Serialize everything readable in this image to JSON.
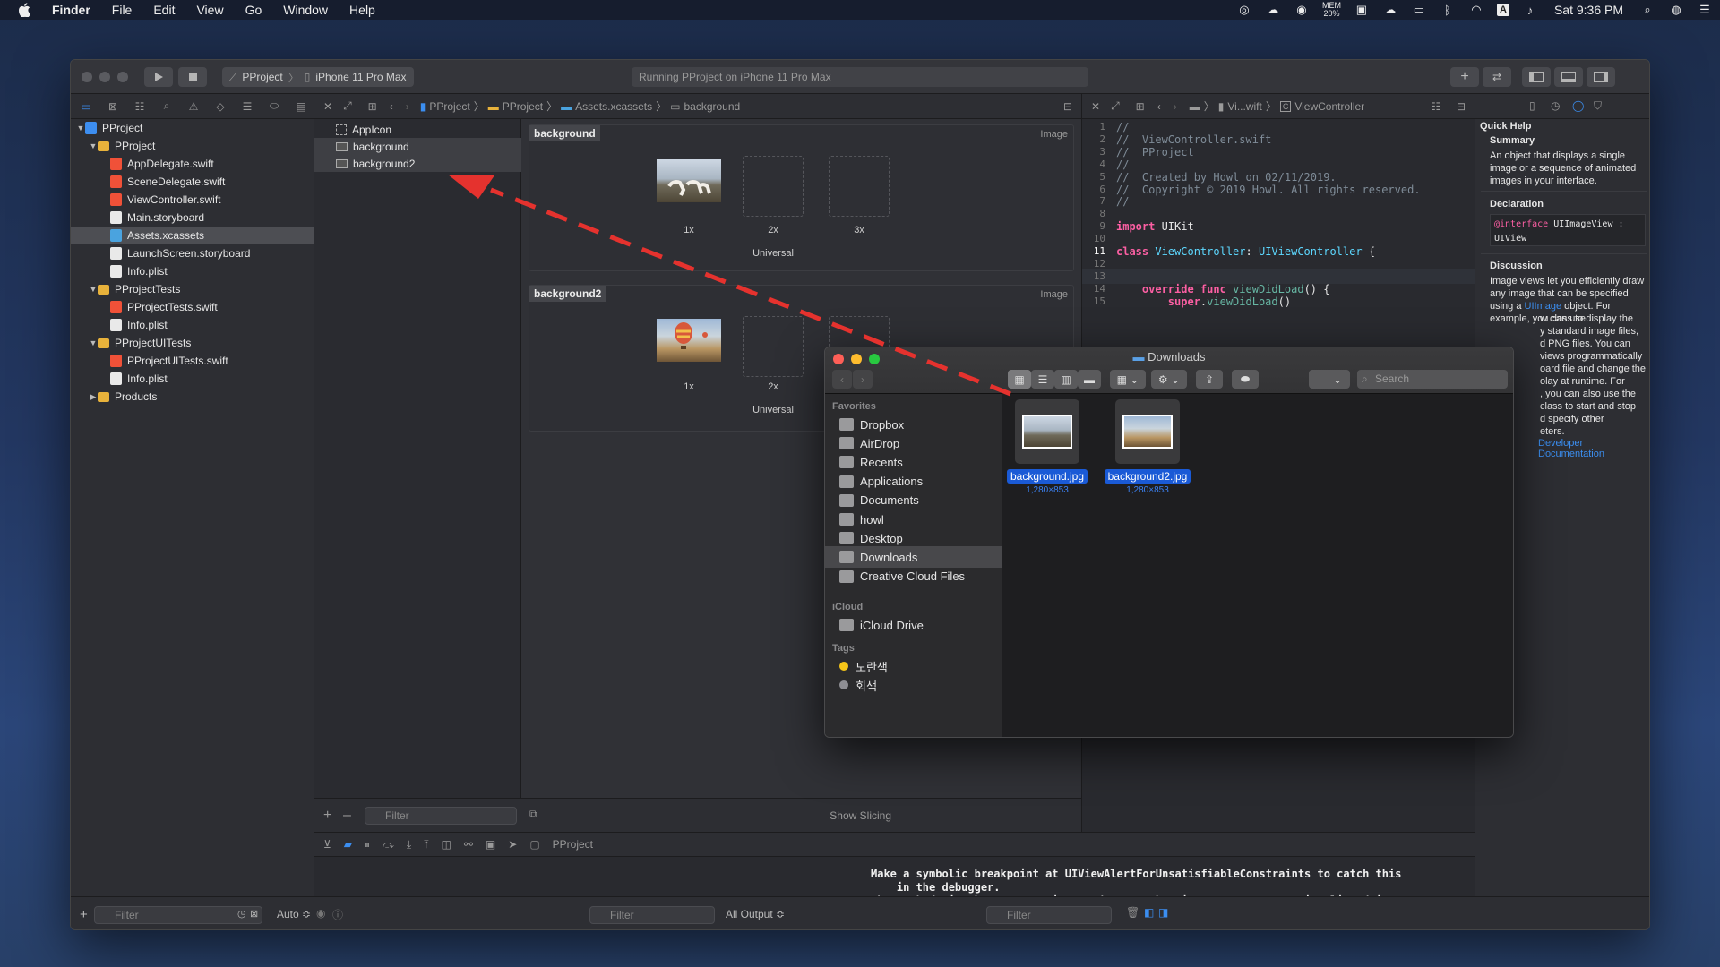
{
  "menubar": {
    "app": "Finder",
    "items": [
      "File",
      "Edit",
      "View",
      "Go",
      "Window",
      "Help"
    ],
    "mem": "MEM",
    "mem_pct": "20%",
    "clock": "Sat 9:36 PM"
  },
  "toolbar": {
    "scheme_project": "PProject",
    "scheme_device": "iPhone 11 Pro Max",
    "activity": "Running PProject on iPhone 11 Pro Max"
  },
  "navigator": {
    "tree": [
      {
        "label": "PProject",
        "kind": "proj",
        "level": 0,
        "disc": "▼"
      },
      {
        "label": "PProject",
        "kind": "folder",
        "level": 1,
        "disc": "▼"
      },
      {
        "label": "AppDelegate.swift",
        "kind": "swift",
        "level": 2
      },
      {
        "label": "SceneDelegate.swift",
        "kind": "swift",
        "level": 2
      },
      {
        "label": "ViewController.swift",
        "kind": "swift",
        "level": 2
      },
      {
        "label": "Main.storyboard",
        "kind": "doc",
        "level": 2
      },
      {
        "label": "Assets.xcassets",
        "kind": "xcas",
        "level": 2,
        "selected": true
      },
      {
        "label": "LaunchScreen.storyboard",
        "kind": "doc",
        "level": 2
      },
      {
        "label": "Info.plist",
        "kind": "doc",
        "level": 2
      },
      {
        "label": "PProjectTests",
        "kind": "folder",
        "level": 1,
        "disc": "▼"
      },
      {
        "label": "PProjectTests.swift",
        "kind": "swift",
        "level": 2
      },
      {
        "label": "Info.plist",
        "kind": "doc",
        "level": 2
      },
      {
        "label": "PProjectUITests",
        "kind": "folder",
        "level": 1,
        "disc": "▼"
      },
      {
        "label": "PProjectUITests.swift",
        "kind": "swift",
        "level": 2
      },
      {
        "label": "Info.plist",
        "kind": "doc",
        "level": 2
      },
      {
        "label": "Products",
        "kind": "folder",
        "level": 1,
        "disc": "▶"
      }
    ],
    "filter_placeholder": "Filter"
  },
  "assets": {
    "breadcrumb": [
      "PProject",
      "PProject",
      "Assets.xcassets",
      "background"
    ],
    "list": [
      {
        "label": "AppIcon"
      },
      {
        "label": "background",
        "selected": true
      },
      {
        "label": "background2",
        "selected": true
      }
    ],
    "sets": [
      {
        "name": "background",
        "type": "Image",
        "scales": [
          "1x",
          "2x",
          "3x"
        ],
        "group": "Universal"
      },
      {
        "name": "background2",
        "type": "Image",
        "scales": [
          "1x",
          "2x"
        ],
        "group": "Universal"
      }
    ],
    "filter_placeholder": "Filter",
    "show_slicing": "Show Slicing"
  },
  "editor": {
    "breadcrumb_file": "Vi...wift",
    "breadcrumb_symbol": "ViewController",
    "lines": [
      {
        "n": "1",
        "segs": [
          {
            "t": "//",
            "c": "cmt"
          }
        ]
      },
      {
        "n": "2",
        "segs": [
          {
            "t": "//  ViewController.swift",
            "c": "cmt"
          }
        ]
      },
      {
        "n": "3",
        "segs": [
          {
            "t": "//  PProject",
            "c": "cmt"
          }
        ]
      },
      {
        "n": "4",
        "segs": [
          {
            "t": "//",
            "c": "cmt"
          }
        ]
      },
      {
        "n": "5",
        "segs": [
          {
            "t": "//  Created by Howl on 02/11/2019.",
            "c": "cmt"
          }
        ]
      },
      {
        "n": "6",
        "segs": [
          {
            "t": "//  Copyright © 2019 Howl. All rights reserved.",
            "c": "cmt"
          }
        ]
      },
      {
        "n": "7",
        "segs": [
          {
            "t": "//",
            "c": "cmt"
          }
        ]
      },
      {
        "n": "8",
        "segs": []
      },
      {
        "n": "9",
        "segs": [
          {
            "t": "import",
            "c": "kw"
          },
          {
            "t": " UIKit",
            "c": ""
          }
        ]
      },
      {
        "n": "10",
        "segs": []
      },
      {
        "n": "11",
        "segs": [
          {
            "t": "class",
            "c": "kw"
          },
          {
            "t": " ",
            "c": ""
          },
          {
            "t": "ViewController",
            "c": "ty"
          },
          {
            "t": ": ",
            "c": ""
          },
          {
            "t": "UIViewController",
            "c": "ty"
          },
          {
            "t": " {",
            "c": ""
          }
        ]
      },
      {
        "n": "12",
        "segs": []
      },
      {
        "n": "13",
        "segs": []
      },
      {
        "n": "14",
        "segs": [
          {
            "t": "    ",
            "c": ""
          },
          {
            "t": "override",
            "c": "kw"
          },
          {
            "t": " ",
            "c": ""
          },
          {
            "t": "func",
            "c": "kw"
          },
          {
            "t": " ",
            "c": ""
          },
          {
            "t": "viewDidLoad",
            "c": "fn"
          },
          {
            "t": "() {",
            "c": ""
          }
        ]
      },
      {
        "n": "15",
        "segs": [
          {
            "t": "        ",
            "c": ""
          },
          {
            "t": "super",
            "c": "kw"
          },
          {
            "t": ".",
            "c": ""
          },
          {
            "t": "viewDidLoad",
            "c": "fn"
          },
          {
            "t": "()",
            "c": ""
          }
        ]
      }
    ]
  },
  "quickhelp": {
    "title": "Quick Help",
    "summary_h": "Summary",
    "summary": "An object that displays a single image or a sequence of animated images in your interface.",
    "declaration_h": "Declaration",
    "decl_kw": "@interface",
    "decl_rest": " UIImageView :",
    "decl_line2": "UIView",
    "discussion_h": "Discussion",
    "discussion_1": "Image views let you efficiently draw any image that can be specified using a",
    "discussion_link": "UIImage",
    "discussion_2": " object. For example, you can use",
    "discussion_rest": [
      "w class to display the",
      "y standard image files,",
      "d PNG files. You can",
      "views programmatically",
      "oard file and change the",
      "olay at runtime. For",
      ", you can also use the",
      "class to start and stop",
      "d specify other",
      "eters."
    ],
    "doc_link": "Developer Documentation"
  },
  "debug": {
    "target": "PProject",
    "console": "Make a symbolic breakpoint at UIViewAlertForUnsatisfiableConstraints to catch this\n    in the debugger.\nThe methods in the UIConstraintBasedLayoutDebugging category on UIView listed in\n    <UIKitCore/UIView.h> may also be helpful.",
    "auto": "Auto ≎",
    "filter_placeholder": "Filter",
    "output": "All Output ≎"
  },
  "finder": {
    "title": "Downloads",
    "search_placeholder": "Search",
    "favorites_h": "Favorites",
    "favorites": [
      {
        "label": "Dropbox",
        "icon": "folder-icon"
      },
      {
        "label": "AirDrop",
        "icon": "airdrop-icon"
      },
      {
        "label": "Recents",
        "icon": "clock-icon"
      },
      {
        "label": "Applications",
        "icon": "applications-icon"
      },
      {
        "label": "Documents",
        "icon": "document-icon"
      },
      {
        "label": "howl",
        "icon": "home-icon"
      },
      {
        "label": "Desktop",
        "icon": "desktop-icon"
      },
      {
        "label": "Downloads",
        "icon": "download-icon",
        "selected": true
      },
      {
        "label": "Creative Cloud Files",
        "icon": "cloud-icon"
      }
    ],
    "icloud_h": "iCloud",
    "icloud": [
      {
        "label": "iCloud Drive",
        "icon": "icloud-icon"
      }
    ],
    "tags_h": "Tags",
    "tags": [
      {
        "label": "노란색",
        "color": "#f5c518"
      },
      {
        "label": "회색",
        "color": "#8e8e93"
      }
    ],
    "files": [
      {
        "name": "background.jpg",
        "meta": "1,280×853",
        "img": "horses"
      },
      {
        "name": "background2.jpg",
        "meta": "1,280×853",
        "img": "balloon"
      }
    ]
  },
  "colors": {
    "accent": "#3b8ef0",
    "arrow": "#e5322e",
    "selection": "#1a5ad6"
  }
}
